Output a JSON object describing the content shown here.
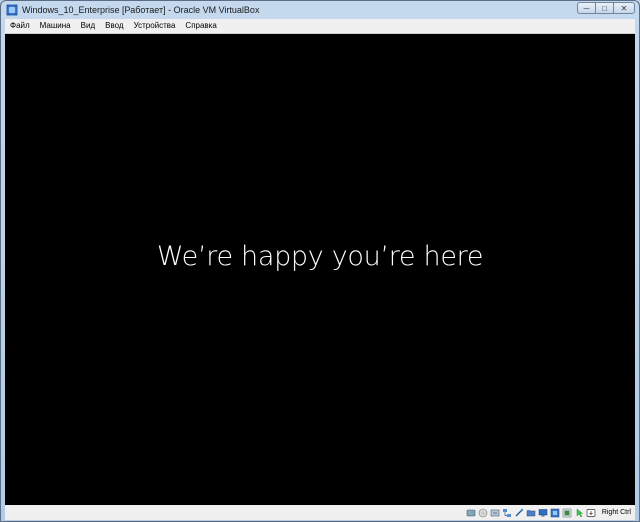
{
  "window": {
    "title": "Windows_10_Enterprise [Работает] - Oracle VM VirtualBox",
    "minimize_glyph": "─",
    "maximize_glyph": "□",
    "close_glyph": "✕"
  },
  "menu": {
    "items": [
      "Файл",
      "Машина",
      "Вид",
      "Ввод",
      "Устройства",
      "Справка"
    ]
  },
  "vm_screen": {
    "message": "We’re happy you’re here",
    "background": "#000000",
    "text_color": "#ffffff"
  },
  "statusbar": {
    "icons": [
      "hard-disk-icon",
      "optical-drive-icon",
      "audio-icon",
      "network-icon",
      "usb-icon",
      "shared-folders-icon",
      "display-icon",
      "video-capture-icon",
      "virtualization-icon",
      "mouse-integration-icon",
      "keyboard-icon"
    ],
    "host_key": "Right Ctrl"
  },
  "colors": {
    "frame": "#b3cbe6",
    "close_button": "#c7d6e8"
  }
}
